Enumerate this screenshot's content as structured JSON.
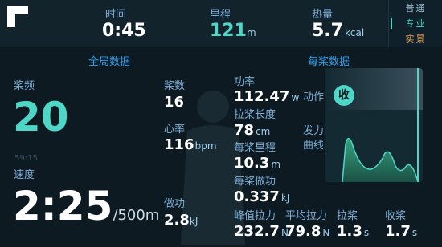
{
  "top": {
    "time": {
      "label": "时间",
      "value": "0:45"
    },
    "distance": {
      "label": "里程",
      "value": "121",
      "unit": "m"
    },
    "calories": {
      "label": "热量",
      "value": "5.7",
      "unit": "kcal"
    }
  },
  "modes": [
    {
      "label": "普通",
      "active": false
    },
    {
      "label": "专业",
      "active": true
    },
    {
      "label": "实景",
      "active": false
    }
  ],
  "global": {
    "title": "全局数据",
    "stroke_rate": {
      "label": "桨频",
      "value": "20"
    },
    "overlay": "59:15",
    "speed": {
      "label": "速度",
      "value": "2:25",
      "unit": "/500m"
    },
    "stroke_count": {
      "label": "桨数",
      "value": "16"
    },
    "heart_rate": {
      "label": "心率",
      "value": "116",
      "unit": "bpm"
    },
    "work": {
      "label": "做功",
      "value": "2.8",
      "unit": "kJ"
    }
  },
  "per_stroke": {
    "title": "每桨数据",
    "power": {
      "label": "功率",
      "value": "112.47",
      "unit": "w"
    },
    "stroke_length": {
      "label": "拉桨长度",
      "value": "78",
      "unit": "cm"
    },
    "stroke_distance": {
      "label": "每桨里程",
      "value": "10.3",
      "unit": "m"
    },
    "stroke_work": {
      "label": "每桨做功",
      "value": "0.337",
      "unit": "kJ"
    },
    "peak_force": {
      "label": "峰值拉力",
      "value": "232.7",
      "unit": "N"
    },
    "avg_force": {
      "label": "平均拉力",
      "value": "79.8",
      "unit": "N"
    },
    "drive": {
      "label": "拉桨",
      "value": "1.3",
      "unit": "s"
    },
    "recovery": {
      "label": "收桨",
      "value": "1.7",
      "unit": "s"
    }
  },
  "action": {
    "label": "动作",
    "state": "收"
  },
  "force_curve": {
    "label_line1": "发力",
    "label_line2": "曲线"
  },
  "colors": {
    "accent": "#4ed7c7",
    "label": "#7fb0d9",
    "section": "#2f9ee8",
    "background": "#0e1a21",
    "mode_inactive": "#a7c3d8",
    "mode_realscene": "#e8a14f"
  }
}
